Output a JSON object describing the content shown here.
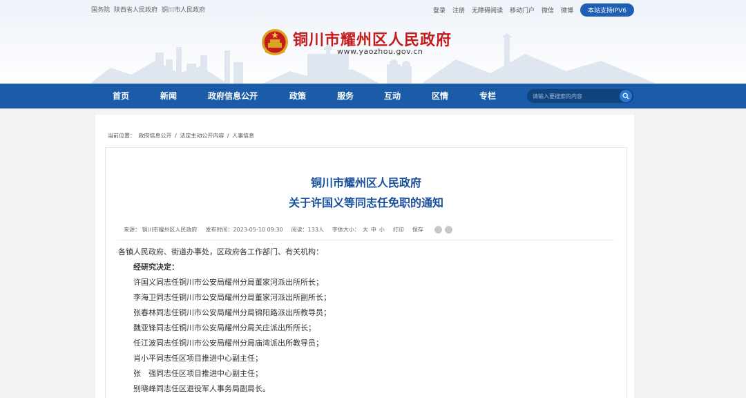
{
  "topbar": {
    "links_left": [
      "国务院",
      "陕西省人民政府",
      "铜川市人民政府"
    ],
    "links_right": [
      "登录",
      "注册",
      "无障碍阅读",
      "移动门户",
      "微信",
      "微博"
    ],
    "ipv6_label": "本站支持IPV6"
  },
  "site": {
    "title": "铜川市耀州区人民政府",
    "url": "www.yaozhou.gov.cn"
  },
  "nav": {
    "items": [
      "首页",
      "新闻",
      "政府信息公开",
      "政策",
      "服务",
      "互动",
      "区情",
      "专栏"
    ],
    "search_placeholder": "请输入要搜索的内容"
  },
  "breadcrumb": {
    "prefix": "当前位置：",
    "items": [
      "政府信息公开",
      "法定主动公开内容",
      "人事信息"
    ],
    "separator": " / "
  },
  "article": {
    "title_line1": "铜川市耀州区人民政府",
    "title_line2": "关于许国义等同志任免职的通知",
    "meta": {
      "source": "来源：  铜川市耀州区人民政府",
      "time": "发布时间：2023-05-10 09:30",
      "views": "阅读：133人",
      "font_size_label": "字体大小：",
      "font_sizes": [
        "大",
        "中",
        "小"
      ],
      "print": "打印",
      "save": "保存"
    },
    "body": {
      "greeting": "各镇人民政府、街道办事处，区政府各工作部门、有关机构：",
      "decision": "经研究决定：",
      "lines": [
        "许国义同志任铜川市公安局耀州分局董家河派出所所长；",
        "李海卫同志任铜川市公安局耀州分局董家河派出所副所长；",
        "张春林同志任铜川市公安局耀州分局锦阳路派出所教导员；",
        "魏亚锋同志任铜川市公安局耀州分局关庄派出所所长；",
        "任江波同志任铜川市公安局耀州分局庙湾派出所教导员；",
        "肖小平同志任区项目推进中心副主任；",
        "张　强同志任区项目推进中心副主任；",
        "别晓峰同志任区退役军人事务局副局长。"
      ]
    }
  },
  "colors": {
    "nav_bg": "#1a5ca8",
    "title_red": "#c41c1c",
    "article_title_blue": "#1a4f9a",
    "ipv6_btn": "#1f5fb3"
  }
}
